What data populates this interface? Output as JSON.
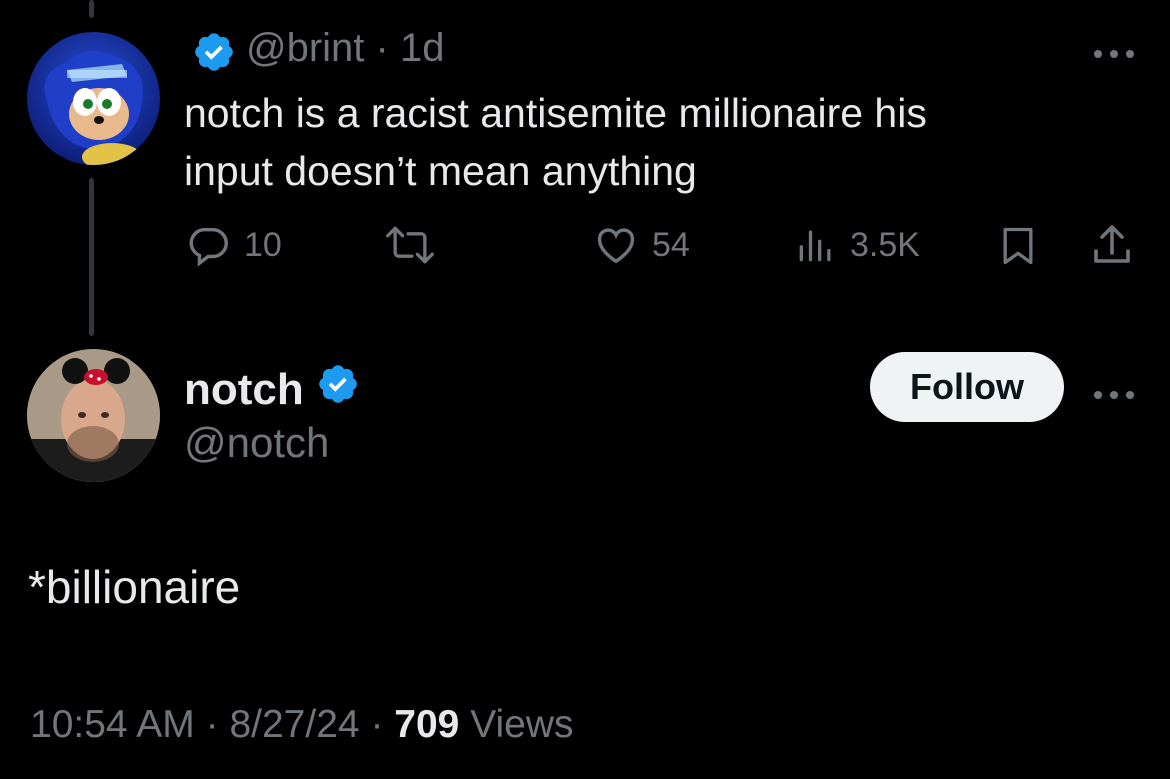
{
  "parent_tweet": {
    "handle": "@brint",
    "time": "1d",
    "separator": "·",
    "text_line1": "notch is a racist antisemite millionaire his",
    "text_line2": "input doesn’t mean anything",
    "stats": {
      "replies": "10",
      "likes": "54",
      "views": "3.5K"
    }
  },
  "main_tweet": {
    "display_name": "notch",
    "handle": "@notch",
    "follow_label": "Follow",
    "text": "*billionaire",
    "time": "10:54 AM",
    "date": "8/27/24",
    "separator": "·",
    "views_count": "709",
    "views_label": "Views"
  },
  "colors": {
    "background": "#000000",
    "text_primary": "#e7e9ea",
    "text_secondary": "#71767b",
    "verified_blue": "#1d9bf0",
    "follow_bg": "#eff3f4"
  },
  "icons": [
    "verified-badge-icon",
    "more-icon",
    "reply-icon",
    "retweet-icon",
    "like-icon",
    "views-icon",
    "bookmark-icon",
    "share-icon"
  ]
}
